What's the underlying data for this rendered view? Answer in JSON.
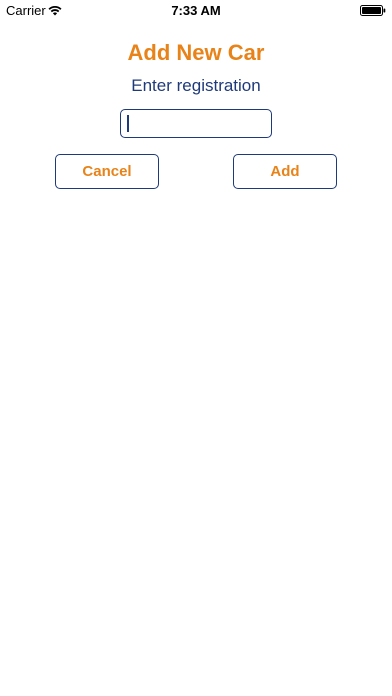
{
  "status_bar": {
    "carrier": "Carrier",
    "time": "7:33 AM",
    "icons": [
      "wifi-icon",
      "battery-icon"
    ]
  },
  "screen": {
    "title": "Add New Car",
    "subtitle": "Enter registration",
    "registration_input": {
      "value": "",
      "placeholder": ""
    },
    "cancel_label": "Cancel",
    "add_label": "Add"
  },
  "colors": {
    "accent_orange": "#E8831A",
    "navy": "#1F3A7A",
    "background": "#FFFFFF"
  }
}
